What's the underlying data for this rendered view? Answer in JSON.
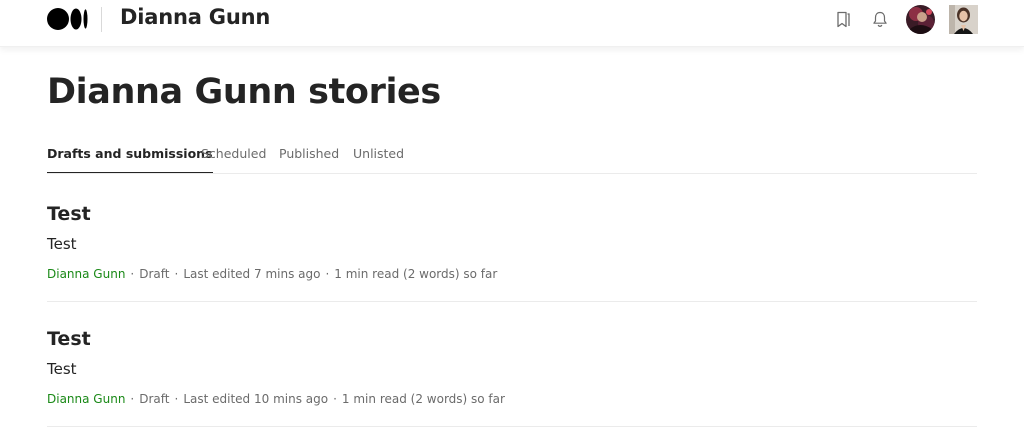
{
  "header": {
    "publication_name": "Dianna Gunn",
    "logo_icon": "medium-logo-icon",
    "bookmark_icon": "bookmark-icon",
    "notifications_icon": "bell-icon",
    "avatar_icon": "publication-avatar",
    "user_avatar_icon": "user-avatar"
  },
  "page": {
    "title": "Dianna Gunn stories"
  },
  "tabs": [
    {
      "label": "Drafts and submissions",
      "active": true
    },
    {
      "label": "Scheduled",
      "active": false
    },
    {
      "label": "Published",
      "active": false
    },
    {
      "label": "Unlisted",
      "active": false
    }
  ],
  "stories": [
    {
      "title": "Test",
      "subtitle": "Test",
      "author": "Dianna Gunn",
      "status": "Draft",
      "last_edited": "Last edited 7 mins ago",
      "read_info": "1 min read (2 words) so far"
    },
    {
      "title": "Test",
      "subtitle": "Test",
      "author": "Dianna Gunn",
      "status": "Draft",
      "last_edited": "Last edited 10 mins ago",
      "read_info": "1 min read (2 words) so far"
    }
  ],
  "colors": {
    "text_primary": "#242424",
    "text_secondary": "#6b6b6b",
    "author_green": "#1a8917",
    "divider": "#ebebeb"
  }
}
